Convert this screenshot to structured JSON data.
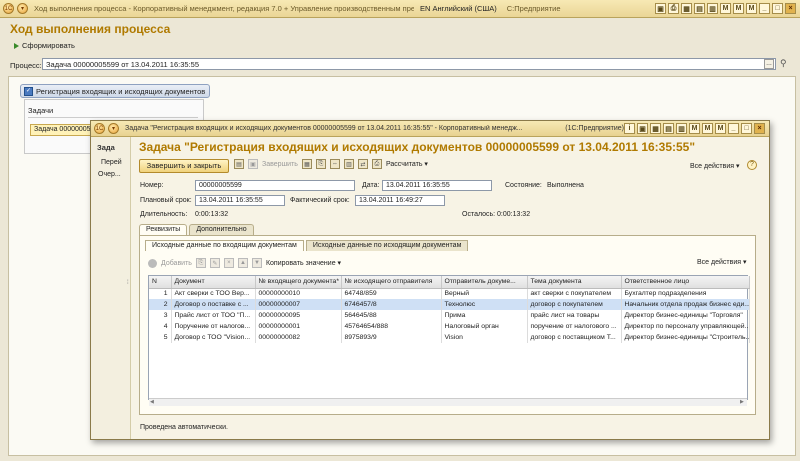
{
  "main_window": {
    "title": "Ход выполнения процесса - Корпоративный менеджмент, редакция 7.0 + Управление производственным предприятием,",
    "lang": "EN Английский (США)",
    "app": "С:Предприятие",
    "header": "Ход выполнения процесса",
    "form_button": "Сформировать",
    "process_label": "Процесс:",
    "process_value": "Задача 00000005599 от 13.04.2011 16:35:55",
    "node_title": "Регистрация входящих и исходящих документов",
    "node_tasks": "Задачи",
    "node_task_item": "Задача 00000005..."
  },
  "dialog": {
    "title": "Задача \"Регистрация входящих и исходящих документов  00000005599 от 13.04.2011 16:35:55\" - Корпоративный менедж...",
    "app": "(1С:Предприятие)",
    "side_title": "Зада",
    "side_a": "Перей",
    "side_b": "Очер...",
    "header": "Задача \"Регистрация входящих и исходящих документов  00000005599 от 13.04.2011 16:35:55\"",
    "btn_save_close": "Завершить и закрыть",
    "btn_finish": "Завершить",
    "btn_calc": "Рассчитать ▾",
    "all_actions": "Все действия ▾",
    "help": "?",
    "num_label": "Номер:",
    "num_value": "00000005599",
    "date_label": "Дата:",
    "date_value": "13.04.2011 16:35:55",
    "state_label": "Состояние:",
    "state_value": "Выполнена",
    "plan_label": "Плановый срок:",
    "plan_value": "13.04.2011 16:35:55",
    "fact_label": "Фактический срок:",
    "fact_value": "13.04.2011 16:49:27",
    "dur_label": "Длительность:",
    "dur_value": "0:00:13:32",
    "left_label": "Осталось:",
    "left_value": "0:00:13:32",
    "tab1": "Реквизиты",
    "tab2": "Дополнительно",
    "subtab1": "Исходные данные по входящим документам",
    "subtab2": "Исходные данные по исходящим документам",
    "tb_add": "Добавить",
    "tb_copy": "Копировать значение ▾",
    "tb_all": "Все действия ▾",
    "status": "Проведена автоматически."
  },
  "table": {
    "headers": [
      "N",
      "Документ",
      "№ входящего документа*",
      "№ исходящего отправителя",
      "Отправитель докуме...",
      "Тема документа",
      "Ответственное лицо"
    ],
    "rows": [
      [
        "1",
        "Акт сверки с ТОО Вер...",
        "00000000010",
        "64748/859",
        "Верный",
        "акт сверки с покупателем",
        "Бухгалтер подразделения"
      ],
      [
        "2",
        "Договор о поставке с ...",
        "00000000007",
        "6746457/8",
        "Технолюс",
        "договор с покупателем",
        "Начальник отдела продаж бизнес еди..."
      ],
      [
        "3",
        "Прайс лист от ТОО \"П...",
        "00000000095",
        "564645/88",
        "Прима",
        "прайс лист на товары",
        "Директор бизнес-единицы \"Торговля\""
      ],
      [
        "4",
        "Поручение от налогов...",
        "00000000001",
        "45764654/888",
        "Налоговый орган",
        "поручение от налогового ...",
        "Директор по персоналу управляющей..."
      ],
      [
        "5",
        "Договор с ТОО \"Vision...",
        "00000000082",
        "8975893/9",
        "Vision",
        "договор с поставщиком Т...",
        "Директор бизнес-единицы \"Строитель..."
      ]
    ]
  }
}
